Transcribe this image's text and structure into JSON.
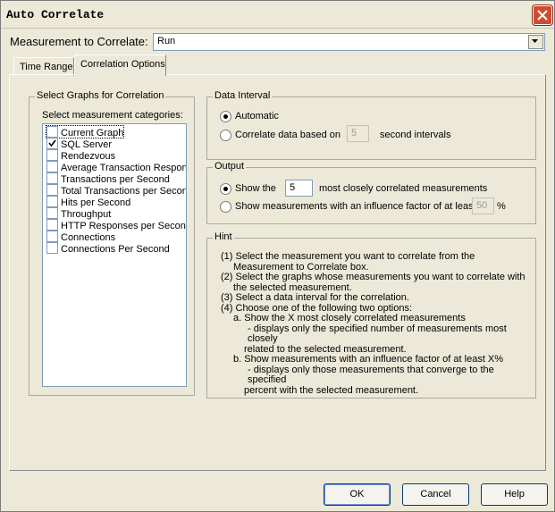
{
  "window": {
    "title": "Auto Correlate"
  },
  "measurement": {
    "label": "Measurement to Correlate:",
    "value": "Run"
  },
  "tabs": [
    {
      "label": "Time Range"
    },
    {
      "label": "Correlation Options"
    }
  ],
  "select_graphs": {
    "group_label": "Select Graphs for Correlation",
    "categories_label": "Select measurement categories:",
    "items": [
      {
        "label": "Current Graph",
        "checked": false
      },
      {
        "label": "SQL Server",
        "checked": true
      },
      {
        "label": "Rendezvous",
        "checked": false
      },
      {
        "label": "Average Transaction Respon",
        "checked": false
      },
      {
        "label": "Transactions per Second",
        "checked": false
      },
      {
        "label": "Total Transactions per Secon",
        "checked": false
      },
      {
        "label": "Hits per Second",
        "checked": false
      },
      {
        "label": "Throughput",
        "checked": false
      },
      {
        "label": "HTTP Responses per Secon",
        "checked": false
      },
      {
        "label": "Connections",
        "checked": false
      },
      {
        "label": "Connections Per Second",
        "checked": false
      }
    ]
  },
  "data_interval": {
    "group_label": "Data Interval",
    "automatic_label": "Automatic",
    "correlate_label": "Correlate data based on",
    "correlate_value": "5",
    "correlate_suffix": "second intervals"
  },
  "output": {
    "group_label": "Output",
    "show_label": "Show the",
    "show_value": "5",
    "show_suffix": "most closely correlated measurements",
    "influence_label": "Show measurements with an influence factor of at least",
    "influence_value": "50",
    "influence_suffix": "%"
  },
  "hint": {
    "group_label": "Hint",
    "lines": [
      "(1) Select the measurement you want to correlate from the",
      "Measurement to Correlate box.",
      "(2) Select the graphs whose measurements you want to correlate with",
      "the selected measurement.",
      "(3) Select a data interval for the correlation.",
      "(4) Choose one of the following two options:",
      "a. Show the X most closely correlated measurements",
      "- displays only the specified number of measurements most closely",
      "related to the selected measurement.",
      "b. Show measurements with an influence factor of at least X%",
      "- displays only those measurements that converge to the specified",
      "percent with the selected measurement."
    ]
  },
  "buttons": {
    "ok": "OK",
    "cancel": "Cancel",
    "help": "Help"
  },
  "colors": {
    "dialog_bg": "#ece9d8",
    "close_button": "#d24b2e",
    "input_border": "#7f9db9"
  }
}
